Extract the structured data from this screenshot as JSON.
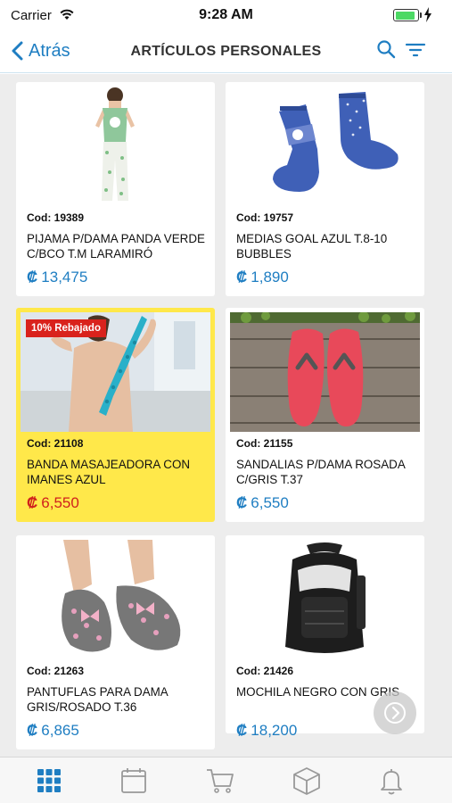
{
  "status_bar": {
    "carrier": "Carrier",
    "time": "9:28 AM"
  },
  "nav": {
    "back_label": "Atrás",
    "title": "ARTÍCULOS PERSONALES"
  },
  "currency_symbol": "₡",
  "products": [
    {
      "code": "Cod: 19389",
      "title": "PIJAMA P/DAMA PANDA VERDE C/BCO T.M LARAMIRÓ",
      "price": "13,475",
      "highlighted": false
    },
    {
      "code": "Cod: 19757",
      "title": "MEDIAS GOAL AZUL T.8-10 BUBBLES",
      "price": "1,890",
      "highlighted": false
    },
    {
      "code": "Cod: 21108",
      "title": "BANDA MASAJEADORA CON IMANES AZUL",
      "price": "6,550",
      "highlighted": true,
      "badge": "10% Rebajado"
    },
    {
      "code": "Cod: 21155",
      "title": "SANDALIAS P/DAMA ROSADA C/GRIS T.37",
      "price": "6,550",
      "highlighted": false
    },
    {
      "code": "Cod: 21263",
      "title": "PANTUFLAS PARA DAMA GRIS/ROSADO T.36",
      "price": "6,865",
      "highlighted": false
    },
    {
      "code": "Cod: 21426",
      "title": "MOCHILA NEGRO CON GRIS",
      "price": "18,200",
      "highlighted": false
    }
  ],
  "colors": {
    "accent": "#1f7ec2",
    "sale_red": "#d0211c",
    "highlight_yellow": "#ffe84a",
    "badge_red": "#d9221c"
  },
  "tab_bar": {
    "active_tab": "grid",
    "tabs": [
      "grid-icon",
      "calendar-icon",
      "cart-icon",
      "box-icon",
      "bell-icon"
    ]
  }
}
